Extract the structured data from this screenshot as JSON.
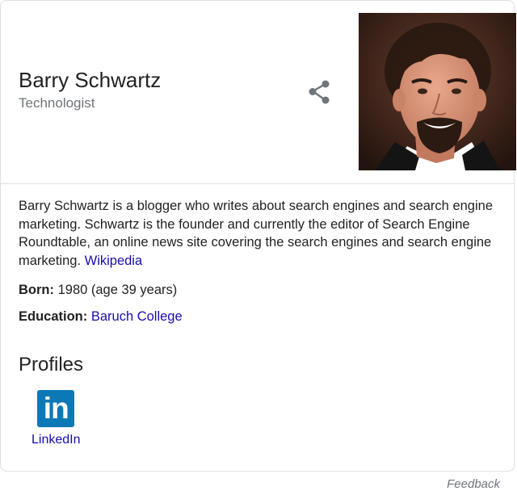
{
  "header": {
    "name": "Barry Schwartz",
    "subtitle": "Technologist",
    "share_icon": "share-icon",
    "photo_icon": "person-photo"
  },
  "description": {
    "text": "Barry Schwartz is a blogger who writes about search engines and search engine marketing. Schwartz is the founder and currently the editor of Search Engine Roundtable, an online news site covering the search engines and search engine marketing.",
    "source_link": "Wikipedia"
  },
  "facts": {
    "born_label": "Born:",
    "born_value": "1980 (age 39 years)",
    "education_label": "Education:",
    "education_value": "Baruch College"
  },
  "profiles": {
    "title": "Profiles",
    "items": [
      {
        "label": "LinkedIn",
        "icon": "linkedin-icon",
        "icon_text": "in",
        "color": "#0b79b6"
      }
    ]
  },
  "footer": {
    "feedback": "Feedback"
  },
  "colors": {
    "link": "#1a0dab",
    "secondary_text": "#70757a",
    "border": "#dfe1e5"
  }
}
